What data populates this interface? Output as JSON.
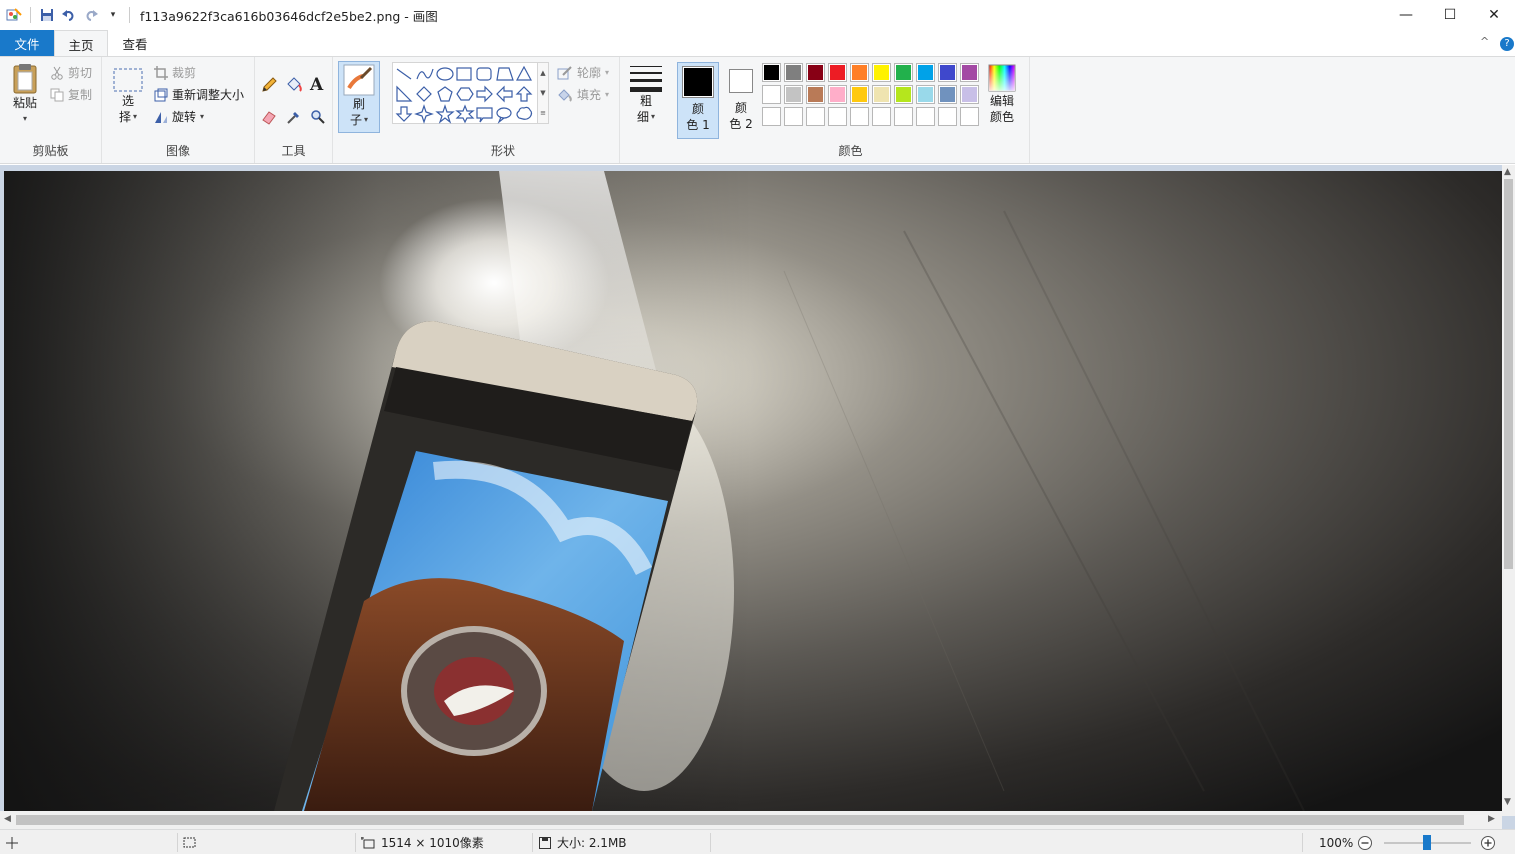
{
  "window": {
    "title": "f113a9622f3ca616b03646dcf2e5be2.png - 画图",
    "minimize": "—",
    "maximize": "☐",
    "close": "✕"
  },
  "tabs": {
    "file": "文件",
    "home": "主页",
    "view": "查看"
  },
  "ribbon": {
    "clipboard": {
      "label": "剪贴板",
      "paste": "粘贴",
      "cut": "剪切",
      "copy": "复制"
    },
    "image": {
      "label": "图像",
      "select": "选",
      "select2": "择",
      "crop": "裁剪",
      "resize": "重新调整大小",
      "rotate": "旋转"
    },
    "tools": {
      "label": "工具"
    },
    "brushes": {
      "label1": "刷",
      "label2": "子"
    },
    "shapes": {
      "label": "形状",
      "outline": "轮廓",
      "fill": "填充"
    },
    "size": {
      "label1": "粗",
      "label2": "细"
    },
    "colors": {
      "label": "颜色",
      "color1_a": "颜",
      "color1_b": "色 1",
      "color2_a": "颜",
      "color2_b": "色 2",
      "edit_a": "编辑",
      "edit_b": "颜色",
      "color1": "#000000",
      "color2": "#ffffff",
      "palette_row1": [
        "#000000",
        "#7f7f7f",
        "#880015",
        "#ed1c24",
        "#ff7f27",
        "#fff200",
        "#22b14c",
        "#00a2e8",
        "#3f48cc",
        "#a349a4"
      ],
      "palette_row2": [
        "#ffffff",
        "#c3c3c3",
        "#b97a57",
        "#ffaec9",
        "#ffc90e",
        "#efe4b0",
        "#b5e61d",
        "#99d9ea",
        "#7092be",
        "#c8bfe7"
      ],
      "palette_row3": [
        "#ffffff",
        "#ffffff",
        "#ffffff",
        "#ffffff",
        "#ffffff",
        "#ffffff",
        "#ffffff",
        "#ffffff",
        "#ffffff",
        "#ffffff"
      ]
    }
  },
  "status": {
    "dimensions": "1514 × 1010像素",
    "size": "大小: 2.1MB",
    "zoom": "100%"
  }
}
